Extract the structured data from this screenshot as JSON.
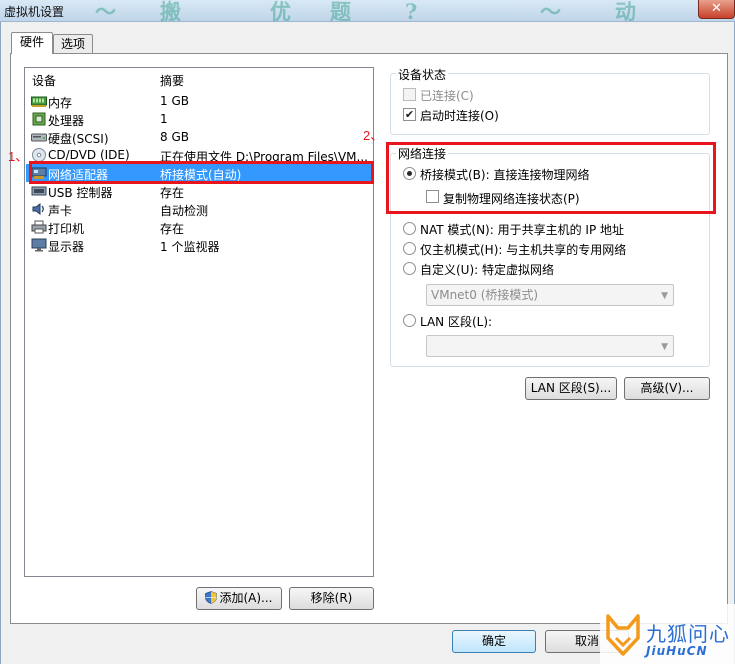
{
  "window": {
    "title": "虚拟机设置",
    "close_glyph": "✕"
  },
  "tabs": [
    {
      "label": "硬件",
      "active": true
    },
    {
      "label": "选项",
      "active": false
    }
  ],
  "device_list": {
    "col_device": "设备",
    "col_summary": "摘要",
    "rows": [
      {
        "device": "内存",
        "summary": "1 GB",
        "icon": "memory-icon"
      },
      {
        "device": "处理器",
        "summary": "1",
        "icon": "cpu-icon"
      },
      {
        "device": "硬盘(SCSI)",
        "summary": "8 GB",
        "icon": "harddisk-icon"
      },
      {
        "device": "CD/DVD (IDE)",
        "summary": "正在使用文件 D:\\Program Files\\VM...",
        "icon": "cd-icon"
      },
      {
        "device": "网络适配器",
        "summary": "桥接模式(自动)",
        "icon": "network-adapter-icon",
        "selected": true
      },
      {
        "device": "USB 控制器",
        "summary": "存在",
        "icon": "usb-icon"
      },
      {
        "device": "声卡",
        "summary": "自动检测",
        "icon": "sound-icon"
      },
      {
        "device": "打印机",
        "summary": "存在",
        "icon": "printer-icon"
      },
      {
        "device": "显示器",
        "summary": "1 个监视器",
        "icon": "monitor-icon"
      }
    ]
  },
  "annotations": {
    "mark1": "1、",
    "mark2": "2、",
    "color": "#e8161c"
  },
  "device_status": {
    "title": "设备状态",
    "connected": {
      "label": "已连接(C)",
      "checked": false,
      "disabled": true
    },
    "connect_at_power_on": {
      "label": "启动时连接(O)",
      "checked": true
    }
  },
  "network_connection": {
    "title": "网络连接",
    "bridged": {
      "label": "桥接模式(B): 直接连接物理网络",
      "selected": true
    },
    "replicate": {
      "label": "复制物理网络连接状态(P)",
      "checked": false
    },
    "nat": {
      "label": "NAT 模式(N): 用于共享主机的 IP 地址",
      "selected": false
    },
    "host_only": {
      "label": "仅主机模式(H): 与主机共享的专用网络",
      "selected": false
    },
    "custom": {
      "label": "自定义(U): 特定虚拟网络",
      "selected": false
    },
    "custom_select": "VMnet0 (桥接模式)",
    "lan_segment": {
      "label": "LAN 区段(L):",
      "selected": false
    },
    "lan_select": ""
  },
  "buttons": {
    "lan_segments": "LAN 区段(S)...",
    "advanced": "高级(V)...",
    "add": "添加(A)...",
    "remove": "移除(R)",
    "ok": "确定",
    "cancel": "取消"
  },
  "watermark": {
    "logo_text": "九狐问心",
    "logo_sub": "JiuHuCN"
  },
  "colors": {
    "selection": "#3399ff",
    "annotation_red": "#e8161c",
    "logo_orange": "#f29a1c",
    "logo_blue": "#2b6fd4"
  }
}
